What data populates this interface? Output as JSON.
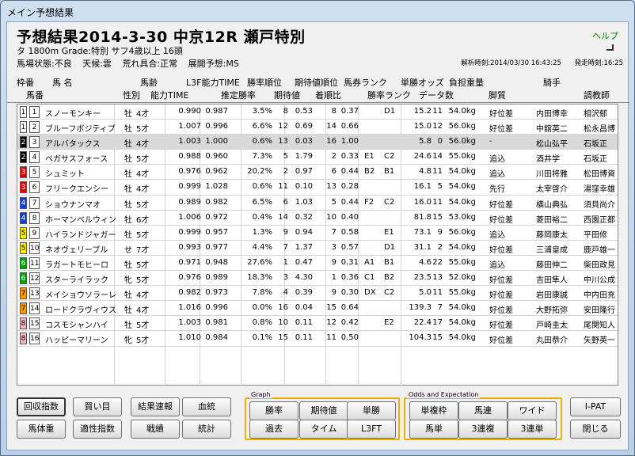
{
  "window": {
    "title": "メイン予想結果"
  },
  "header": {
    "race_title": "予想結果2014-3-30 中京12R 瀬戸特別",
    "race_info": "タ 1800m  Grade:特別 サフ4歳以上 16頭",
    "help": "ヘルプ",
    "conditions": [
      "馬場状態:不良",
      "天候:雲",
      "荒れ具合:正常",
      "展開予想:MS"
    ],
    "analysis_time": "解析時刻:2014/03/30 16:43:25",
    "post_time": "発走時刻:16:25"
  },
  "columns_row1": [
    "枠番",
    "馬 名",
    "馬齢",
    "L3F能力TIME",
    "勝率順位",
    "期待値順位",
    "馬券ランク",
    "単勝オッズ",
    "負担重量",
    "騎手"
  ],
  "columns_row2": [
    "馬番",
    "性別",
    "能力TIME",
    "推定勝率",
    "期待値",
    "着順比",
    "勝率ランク",
    "データ数",
    "脚質",
    "調教師"
  ],
  "rows": [
    {
      "waku": "1",
      "uma": "1",
      "name": "スノーモンキー",
      "sex": "牡",
      "age": "4才",
      "nt": "0.990",
      "l3": "0.987",
      "pr": "3.5%",
      "rk": "8",
      "ev": "0.53",
      "od": "8",
      "hr": "0.37",
      "m1": "",
      "m2": "D1",
      "tod": "15.2",
      "pop": "11",
      "wt": "54.0kg",
      "kyak": "好位差",
      "jockey": "内田博幸",
      "trainer": "相沢郁"
    },
    {
      "waku": "1",
      "uma": "2",
      "name": "ブルーフボジティブ",
      "sex": "牡",
      "age": "5才",
      "nt": "1.007",
      "l3": "0.996",
      "pr": "6.6%",
      "rk": "12",
      "ev": "0.69",
      "od": "14",
      "hr": "0.66",
      "m1": "",
      "m2": "",
      "tod": "15.0",
      "pop": "12",
      "wt": "56.0kg",
      "kyak": "好位差",
      "jockey": "中舘英二",
      "trainer": "松永昌博"
    },
    {
      "waku": "2",
      "uma": "3",
      "name": "アルバタックス",
      "sex": "牡",
      "age": "4才",
      "nt": "1.003",
      "l3": "1.000",
      "pr": "0.6%",
      "rk": "13",
      "ev": "0.03",
      "od": "16",
      "hr": "1.00",
      "m1": "",
      "m2": "",
      "tod": "5.8",
      "pop": "0",
      "wt": "56.0kg",
      "kyak": "-",
      "jockey": "松山弘平",
      "trainer": "石坂正"
    },
    {
      "waku": "2",
      "uma": "4",
      "name": "ペガサスフォース",
      "sex": "牡",
      "age": "5才",
      "nt": "0.988",
      "l3": "0.960",
      "pr": "7.3%",
      "rk": "5",
      "ev": "1.79",
      "od": "2",
      "hr": "0.33",
      "m1": "E1",
      "m2": "C2",
      "tod": "24.6",
      "pop": "14",
      "wt": "55.0kg",
      "kyak": "追込",
      "jockey": "酒井学",
      "trainer": "石坂正"
    },
    {
      "waku": "3",
      "uma": "5",
      "name": "シュミット",
      "sex": "牡",
      "age": "4才",
      "nt": "0.976",
      "l3": "0.962",
      "pr": "20.2%",
      "rk": "2",
      "ev": "0.97",
      "od": "6",
      "hr": "0.44",
      "m1": "B2",
      "m2": "B1",
      "tod": "4.8",
      "pop": "11",
      "wt": "54.0kg",
      "kyak": "追込",
      "jockey": "川田将雅",
      "trainer": "松田博資"
    },
    {
      "waku": "3",
      "uma": "6",
      "name": "フリークエンシー",
      "sex": "牡",
      "age": "4才",
      "nt": "0.999",
      "l3": "1.028",
      "pr": "0.6%",
      "rk": "11",
      "ev": "0.10",
      "od": "13",
      "hr": "0.28",
      "m1": "",
      "m2": "",
      "tod": "16.1",
      "pop": "5",
      "wt": "54.0kg",
      "kyak": "先行",
      "jockey": "太宰啓介",
      "trainer": "湯窪幸雄"
    },
    {
      "waku": "4",
      "uma": "7",
      "name": "ショウナンマオ",
      "sex": "牡",
      "age": "5才",
      "nt": "0.989",
      "l3": "0.982",
      "pr": "6.5%",
      "rk": "6",
      "ev": "1.03",
      "od": "5",
      "hr": "0.44",
      "m1": "F2",
      "m2": "C2",
      "tod": "16.0",
      "pop": "11",
      "wt": "54.0kg",
      "kyak": "好位差",
      "jockey": "横山典弘",
      "trainer": "須貝尚介"
    },
    {
      "waku": "4",
      "uma": "8",
      "name": "ホーマンベルウィン",
      "sex": "牡",
      "age": "6才",
      "nt": "1.006",
      "l3": "0.972",
      "pr": "0.4%",
      "rk": "14",
      "ev": "0.32",
      "od": "10",
      "hr": "0.40",
      "m1": "",
      "m2": "",
      "tod": "81.8",
      "pop": "15",
      "wt": "53.0kg",
      "kyak": "好位差",
      "jockey": "菱田裕二",
      "trainer": "西園正都"
    },
    {
      "waku": "5",
      "uma": "9",
      "name": "ハイランドジャガー",
      "sex": "牡",
      "age": "5才",
      "nt": "0.999",
      "l3": "0.957",
      "pr": "1.3%",
      "rk": "9",
      "ev": "0.94",
      "od": "7",
      "hr": "0.58",
      "m1": "",
      "m2": "E1",
      "tod": "73.1",
      "pop": "9",
      "wt": "56.0kg",
      "kyak": "追込",
      "jockey": "藤岡康太",
      "trainer": "平田修"
    },
    {
      "waku": "5",
      "uma": "10",
      "name": "ネオヴェリーブル",
      "sex": "せ",
      "age": "7才",
      "nt": "0.993",
      "l3": "0.977",
      "pr": "4.4%",
      "rk": "7",
      "ev": "1.37",
      "od": "3",
      "hr": "0.57",
      "m1": "",
      "m2": "D1",
      "tod": "31.1",
      "pop": "2",
      "wt": "54.0kg",
      "kyak": "好位差",
      "jockey": "三浦皇成",
      "trainer": "鹿戸雄一"
    },
    {
      "waku": "6",
      "uma": "11",
      "name": "ラガートモヒーロ",
      "sex": "牡",
      "age": "5才",
      "nt": "0.971",
      "l3": "0.948",
      "pr": "27.6%",
      "rk": "1",
      "ev": "0.47",
      "od": "9",
      "hr": "0.31",
      "m1": "A1",
      "m2": "B1",
      "tod": "4.6",
      "pop": "22",
      "wt": "55.0kg",
      "kyak": "追込",
      "jockey": "藤田伸二",
      "trainer": "柴田政見"
    },
    {
      "waku": "6",
      "uma": "12",
      "name": "スターライラック",
      "sex": "牝",
      "age": "5才",
      "nt": "0.976",
      "l3": "0.989",
      "pr": "18.3%",
      "rk": "3",
      "ev": "4.30",
      "od": "1",
      "hr": "0.36",
      "m1": "C1",
      "m2": "B2",
      "tod": "23.5",
      "pop": "13",
      "wt": "52.0kg",
      "kyak": "好位差",
      "jockey": "吉田隼人",
      "trainer": "中川公成"
    },
    {
      "waku": "7",
      "uma": "13",
      "name": "メイショウソラーレ",
      "sex": "牡",
      "age": "4才",
      "nt": "0.982",
      "l3": "0.973",
      "pr": "7.8%",
      "rk": "4",
      "ev": "0.39",
      "od": "9",
      "hr": "0.30",
      "m1": "DX",
      "m2": "C2",
      "tod": "5.0",
      "pop": "11",
      "wt": "55.0kg",
      "kyak": "好位差",
      "jockey": "岩田康誠",
      "trainer": "中内田充"
    },
    {
      "waku": "7",
      "uma": "14",
      "name": "ロードクラヴィウス",
      "sex": "牡",
      "age": "4才",
      "nt": "1.016",
      "l3": "0.996",
      "pr": "0.0%",
      "rk": "16",
      "ev": "0.04",
      "od": "15",
      "hr": "0.64",
      "m1": "",
      "m2": "",
      "tod": "139.3",
      "pop": "7",
      "wt": "54.0kg",
      "kyak": "好位差",
      "jockey": "大野拓弥",
      "trainer": "安田隆行"
    },
    {
      "waku": "8",
      "uma": "15",
      "name": "コスモシャンハイ",
      "sex": "牡",
      "age": "5才",
      "nt": "1.003",
      "l3": "0.981",
      "pr": "0.8%",
      "rk": "10",
      "ev": "0.11",
      "od": "12",
      "hr": "0.42",
      "m1": "",
      "m2": "E2",
      "tod": "22.4",
      "pop": "17",
      "wt": "54.0kg",
      "kyak": "好位差",
      "jockey": "戸崎圭太",
      "trainer": "尾関知人"
    },
    {
      "waku": "8",
      "uma": "16",
      "name": "ハッピーマリーン",
      "sex": "牝",
      "age": "5才",
      "nt": "1.010",
      "l3": "0.984",
      "pr": "0.1%",
      "rk": "15",
      "ev": "0.11",
      "od": "11",
      "hr": "0.50",
      "m1": "",
      "m2": "",
      "tod": "104.3",
      "pop": "15",
      "wt": "54.0kg",
      "kyak": "好位差",
      "jockey": "丸田恭介",
      "trainer": "矢野英一"
    }
  ],
  "waku_colors": {
    "1": "#ffffff",
    "2": "#000000",
    "3": "#e00000",
    "4": "#1040d0",
    "5": "#ffee00",
    "6": "#00a000",
    "7": "#ff9900",
    "8": "#ffb6c1"
  },
  "buttons_left": {
    "kaishu": "回収指数",
    "kaime": "買い目",
    "kekka": "結果速報",
    "kettou": "血統",
    "bataiju": "馬体重",
    "tekisei": "適性指数",
    "senseki": "戦績",
    "toukei": "統計"
  },
  "graph": {
    "label": "Graph",
    "shoritsu": "勝率",
    "kitaichi": "期待値",
    "tansho": "単勝",
    "kako": "過去",
    "time": "タイム",
    "l3ft": "L3FT"
  },
  "odds": {
    "label": "Odds and Expectation",
    "tanfuku": "単複枠",
    "umaren": "馬連",
    "wide": "ワイド",
    "umatan": "馬単",
    "sanrenpuku": "3連複",
    "sanrentan": "3連単"
  },
  "buttons_right": {
    "ipat": "I-PAT",
    "close": "閉じる"
  }
}
